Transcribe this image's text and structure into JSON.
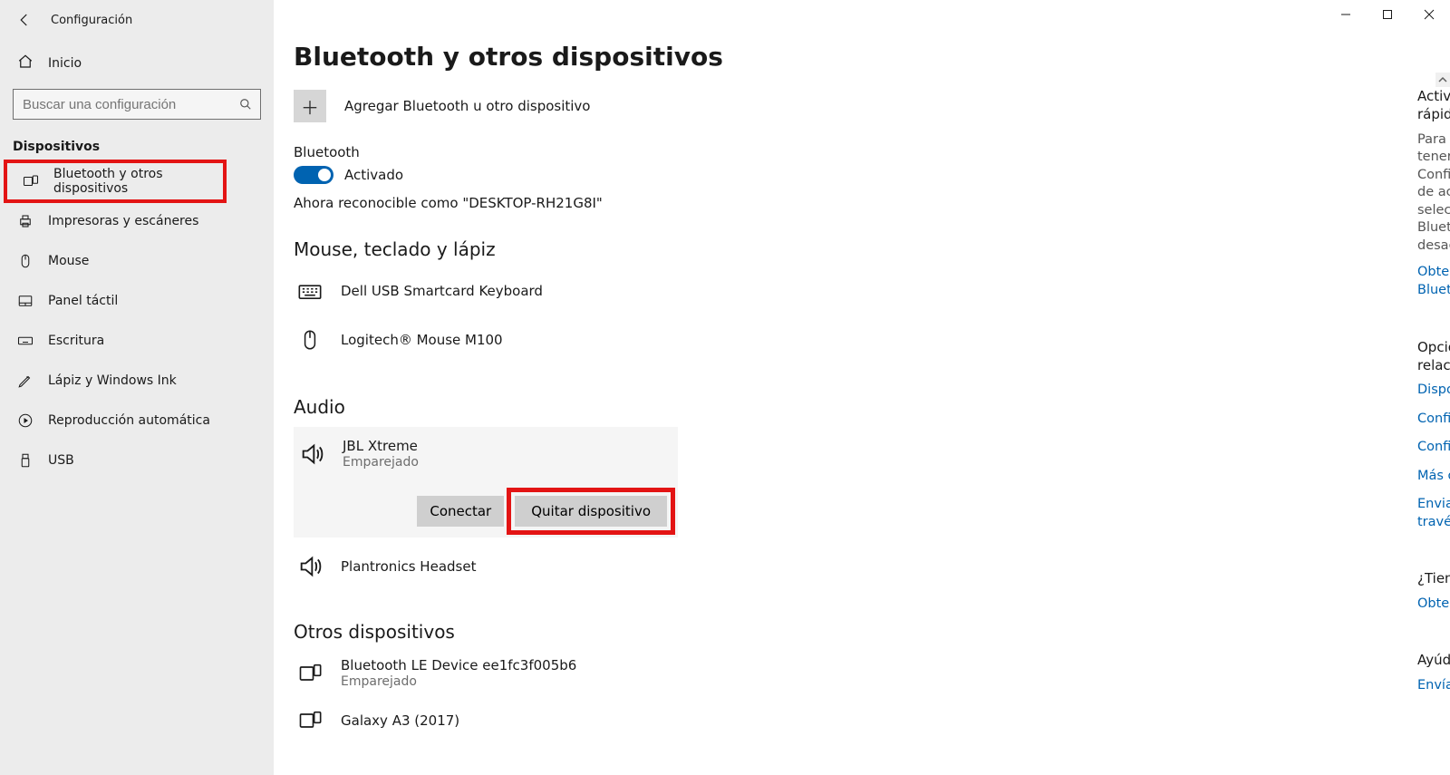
{
  "window": {
    "title": "Configuración"
  },
  "sidebar": {
    "home_label": "Inicio",
    "search_placeholder": "Buscar una configuración",
    "group_label": "Dispositivos",
    "items": [
      {
        "label": "Bluetooth y otros dispositivos"
      },
      {
        "label": "Impresoras y escáneres"
      },
      {
        "label": "Mouse"
      },
      {
        "label": "Panel táctil"
      },
      {
        "label": "Escritura"
      },
      {
        "label": "Lápiz y Windows Ink"
      },
      {
        "label": "Reproducción automática"
      },
      {
        "label": "USB"
      }
    ]
  },
  "page": {
    "title": "Bluetooth y otros dispositivos",
    "add_label": "Agregar Bluetooth u otro dispositivo",
    "bt_section": "Bluetooth",
    "bt_toggle_label": "Activado",
    "discoverable_text": "Ahora reconocible como \"DESKTOP-RH21G8I\"",
    "groups": {
      "mouse": {
        "heading": "Mouse, teclado y lápiz",
        "items": [
          {
            "name": "Dell USB Smartcard Keyboard"
          },
          {
            "name": "Logitech® Mouse M100"
          }
        ]
      },
      "audio": {
        "heading": "Audio",
        "selected": {
          "name": "JBL Xtreme",
          "status": "Emparejado",
          "connect_label": "Conectar",
          "remove_label": "Quitar dispositivo"
        },
        "items": [
          {
            "name": "Plantronics Headset"
          }
        ]
      },
      "other": {
        "heading": "Otros dispositivos",
        "items": [
          {
            "name": "Bluetooth LE Device ee1fc3f005b6",
            "status": "Emparejado"
          },
          {
            "name": "Galaxy A3 (2017)"
          }
        ]
      }
    }
  },
  "info": {
    "fast_bt": {
      "heading": "Activar Bluetooth aún más rápido",
      "body": "Para activar Bluetooth sin tener que abrir la opción Configuración, abre el centro de actividades y luego selecciona el icono de Bluetooth. Haz lo mismo para desactivarlo cuando lo desees.",
      "link": "Obtener más información sobre Bluetooth"
    },
    "related": {
      "heading": "Opciones de configuración relacionadas",
      "links": [
        "Dispositivos e impresoras",
        "Configuración del sonido",
        "Configuración de pantalla",
        "Más opciones de Bluetooth",
        "Enviar o recibir archivos a través de Bluetooth"
      ]
    },
    "question": {
      "heading": "¿Tienes alguna pregunta?",
      "link": "Obtener ayuda"
    },
    "improve": {
      "heading": "Ayúdanos a mejorar Windows",
      "link": "Envíanos tus comentarios"
    }
  }
}
